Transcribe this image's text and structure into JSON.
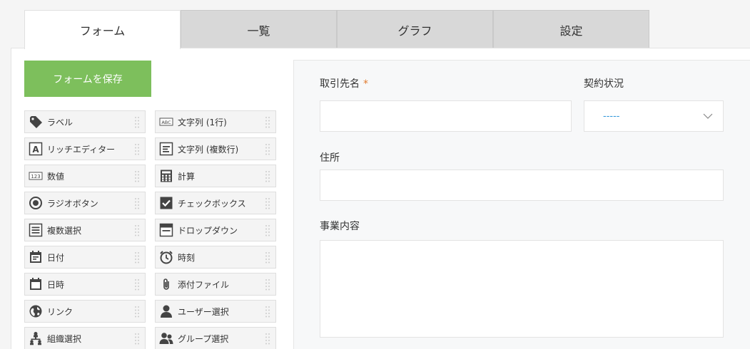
{
  "tabs": [
    {
      "label": "フォーム"
    },
    {
      "label": "一覧"
    },
    {
      "label": "グラフ"
    },
    {
      "label": "設定"
    }
  ],
  "save_button": "フォームを保存",
  "palette": [
    {
      "label": "ラベル",
      "icon": "tag-icon"
    },
    {
      "label": "文字列 (1行)",
      "icon": "abc-icon"
    },
    {
      "label": "リッチエディター",
      "icon": "rich-text-icon"
    },
    {
      "label": "文字列 (複数行)",
      "icon": "multiline-text-icon"
    },
    {
      "label": "数値",
      "icon": "number-icon"
    },
    {
      "label": "計算",
      "icon": "calculator-icon"
    },
    {
      "label": "ラジオボタン",
      "icon": "radio-button-icon"
    },
    {
      "label": "チェックボックス",
      "icon": "checkbox-icon"
    },
    {
      "label": "複数選択",
      "icon": "multi-select-icon"
    },
    {
      "label": "ドロップダウン",
      "icon": "dropdown-icon"
    },
    {
      "label": "日付",
      "icon": "date-icon"
    },
    {
      "label": "時刻",
      "icon": "clock-icon"
    },
    {
      "label": "日時",
      "icon": "datetime-icon"
    },
    {
      "label": "添付ファイル",
      "icon": "paperclip-icon"
    },
    {
      "label": "リンク",
      "icon": "globe-icon"
    },
    {
      "label": "ユーザー選択",
      "icon": "user-icon"
    },
    {
      "label": "組織選択",
      "icon": "org-icon"
    },
    {
      "label": "グループ選択",
      "icon": "group-icon"
    }
  ],
  "form": {
    "client_name_label": "取引先名",
    "required_mark": "*",
    "contract_status_label": "契約状況",
    "contract_status_value": "-----",
    "address_label": "住所",
    "business_label": "事業内容"
  },
  "colors": {
    "accent_green": "#7dbf5c",
    "required_orange": "#e07b2e",
    "select_blue": "#3498db"
  }
}
